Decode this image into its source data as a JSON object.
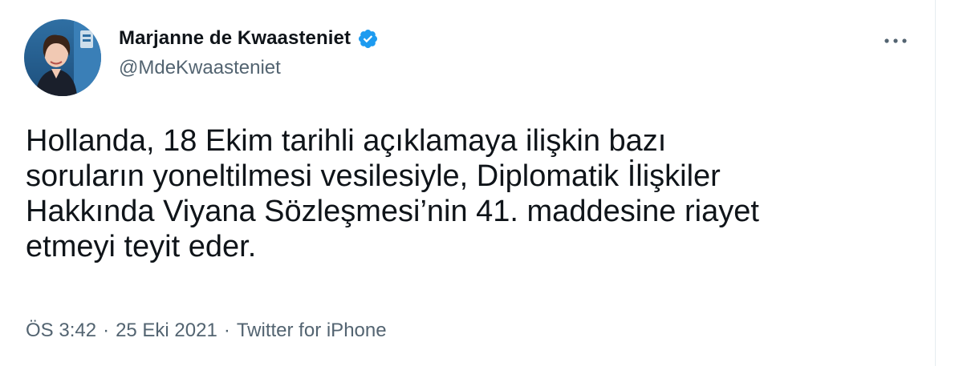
{
  "tweet": {
    "author": {
      "display_name": "Marjanne de Kwaasteniet",
      "handle": "@MdeKwaasteniet",
      "verified": true,
      "avatar_icon": "profile-photo"
    },
    "text": "Hollanda, 18 Ekim tarihli açıklamaya ilişkin bazı\nsoruların yoneltilmesi vesilesiyle, Diplomatik İlişkiler\nHakkında Viyana Sözleşmesi’nin 41. maddesine riayet\netmeyi teyit eder.",
    "time": "ÖS 3:42",
    "separator": "·",
    "date": "25 Eki 2021",
    "source": "Twitter for iPhone",
    "more_icon": "more-horizontal-icon"
  },
  "colors": {
    "text_primary": "#0f1419",
    "text_secondary": "#536471",
    "verified_blue": "#1d9bf0",
    "background": "#ffffff"
  }
}
